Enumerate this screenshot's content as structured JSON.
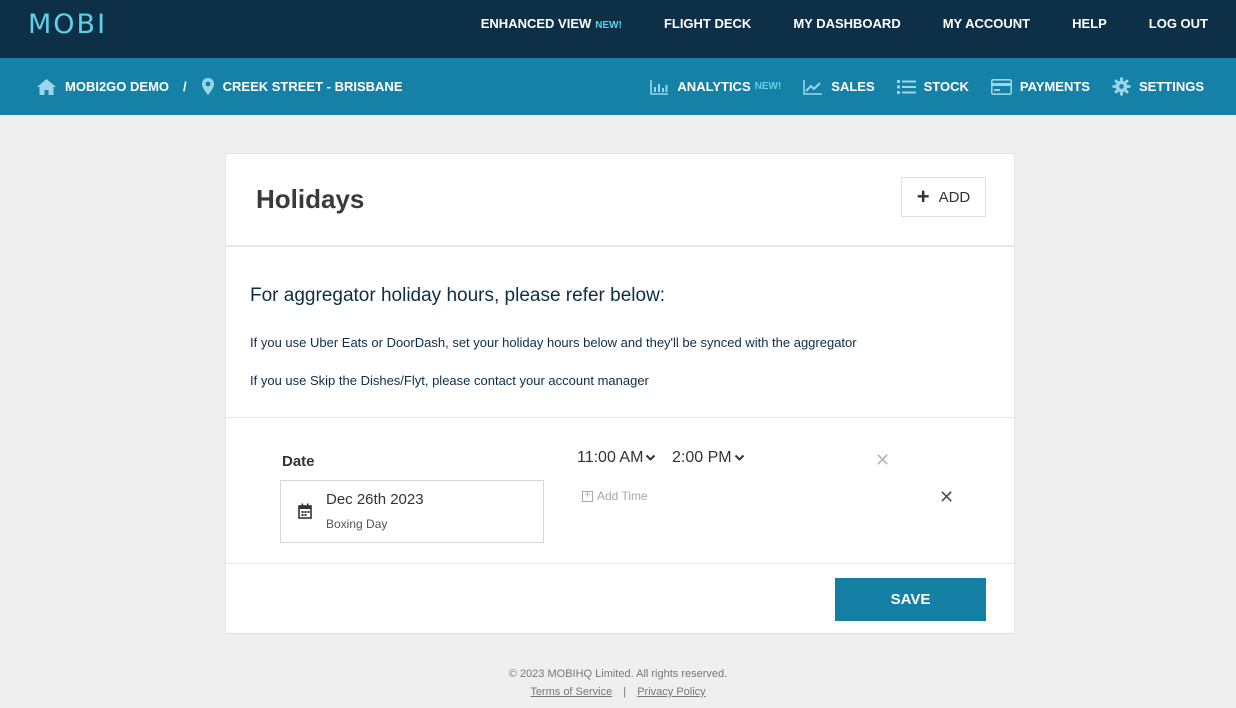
{
  "brand": {
    "logo": "MOBI"
  },
  "topnav": {
    "enhanced_view": "ENHANCED VIEW",
    "enhanced_badge": "NEW!",
    "flight_deck": "FLIGHT DECK",
    "dashboard": "MY DASHBOARD",
    "account": "MY ACCOUNT",
    "help": "HELP",
    "logout": "LOG OUT"
  },
  "breadcrumb": {
    "org": "MOBI2GO DEMO",
    "separator": "/",
    "store": "CREEK STREET - BRISBANE"
  },
  "subnav": {
    "analytics": "ANALYTICS",
    "analytics_badge": "NEW!",
    "sales": "SALES",
    "stock": "STOCK",
    "payments": "PAYMENTS",
    "settings": "SETTINGS"
  },
  "holidays": {
    "title": "Holidays",
    "add_label": "ADD",
    "info_heading": "For aggregator holiday hours, please refer below:",
    "info_line1": "If you use Uber Eats or DoorDash, set your holiday hours below and they'll be synced with the aggregator",
    "info_line2": "If you use Skip the Dishes/Flyt, please contact your account manager",
    "date_label": "Date",
    "entry": {
      "date": "Dec 26th 2023",
      "holiday_name": "Boxing Day",
      "start_time": "11:00 AM",
      "end_time": "2:00 PM",
      "add_time_label": "Add Time"
    },
    "save_label": "SAVE"
  },
  "footer": {
    "copyright": "© 2023 MOBIHQ Limited. All rights reserved.",
    "terms": "Terms of Service",
    "separator": "|",
    "privacy": "Privacy Policy"
  },
  "colors": {
    "topbar": "#0e3047",
    "subbar": "#1681a7",
    "accent": "#5fd0e9",
    "save": "#167fa5"
  }
}
